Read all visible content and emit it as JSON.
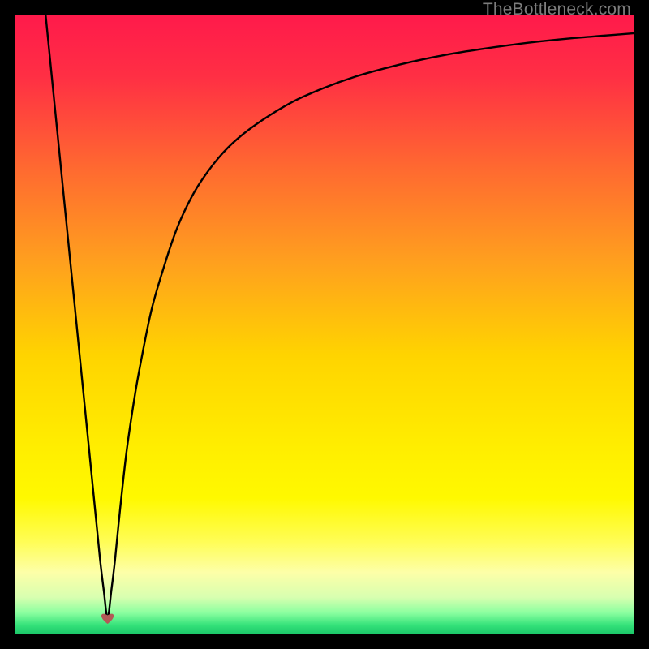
{
  "watermark": "TheBottleneck.com",
  "colors": {
    "gradient_stops": [
      {
        "offset": 0.0,
        "color": "#ff1a4b"
      },
      {
        "offset": 0.1,
        "color": "#ff2f44"
      },
      {
        "offset": 0.25,
        "color": "#ff6a30"
      },
      {
        "offset": 0.4,
        "color": "#ffa01e"
      },
      {
        "offset": 0.55,
        "color": "#ffd400"
      },
      {
        "offset": 0.7,
        "color": "#ffee00"
      },
      {
        "offset": 0.78,
        "color": "#fff900"
      },
      {
        "offset": 0.85,
        "color": "#fffd55"
      },
      {
        "offset": 0.9,
        "color": "#fdffa8"
      },
      {
        "offset": 0.94,
        "color": "#d8ffb0"
      },
      {
        "offset": 0.965,
        "color": "#8cffa0"
      },
      {
        "offset": 0.985,
        "color": "#35e27a"
      },
      {
        "offset": 1.0,
        "color": "#19c668"
      }
    ],
    "curve": "#000000",
    "marker_fill": "#b25a57",
    "marker_stroke": "#b25a57"
  },
  "chart_data": {
    "type": "line",
    "title": "",
    "xlabel": "",
    "ylabel": "",
    "xlim": [
      0,
      100
    ],
    "ylim": [
      0,
      100
    ],
    "grid": false,
    "legend": false,
    "marker": {
      "x": 15,
      "y": 2.6
    },
    "series": [
      {
        "name": "bottleneck-curve",
        "x": [
          5,
          6,
          7,
          8,
          9,
          10,
          11,
          12,
          13,
          13.8,
          14.4,
          15,
          15.6,
          16.2,
          17,
          18,
          19,
          20,
          22,
          24,
          26,
          28,
          30,
          33,
          36,
          40,
          45,
          50,
          55,
          60,
          65,
          70,
          75,
          80,
          85,
          90,
          95,
          100
        ],
        "y": [
          100,
          90,
          80,
          70,
          60,
          50,
          40,
          30,
          20,
          12,
          7,
          2.6,
          7,
          12,
          20,
          29,
          36,
          42,
          52,
          59,
          65,
          69.5,
          73,
          77,
          80,
          83,
          86,
          88.2,
          90,
          91.4,
          92.6,
          93.6,
          94.4,
          95.1,
          95.7,
          96.2,
          96.6,
          97
        ]
      }
    ]
  }
}
